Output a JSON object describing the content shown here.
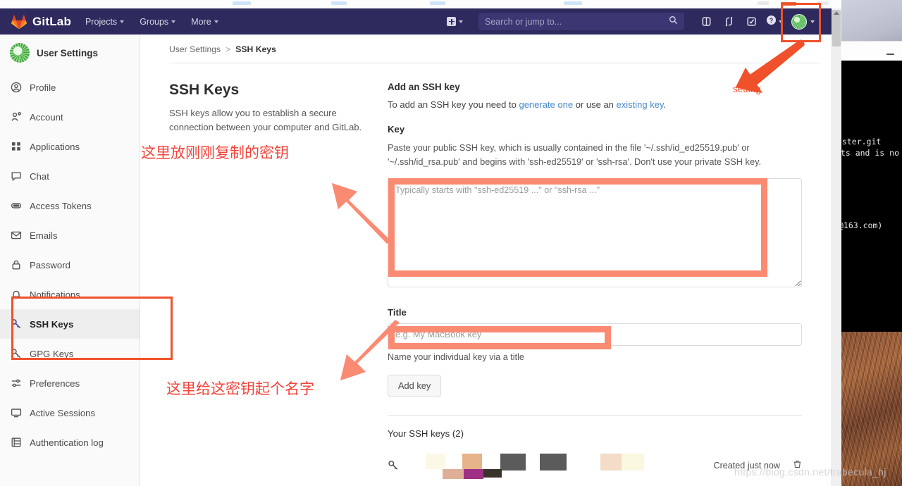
{
  "navbar": {
    "brand": "GitLab",
    "links": [
      {
        "label": "Projects",
        "icon": "chevron-down-icon"
      },
      {
        "label": "Groups",
        "icon": "chevron-down-icon"
      },
      {
        "label": "More",
        "icon": "chevron-down-icon"
      }
    ],
    "search_placeholder": "Search or jump to...",
    "search_value": "",
    "icons": [
      "plus-square-icon",
      "search-icon",
      "issues-icon",
      "merge-requests-icon",
      "todos-icon",
      "help-icon",
      "user-avatar-icon"
    ]
  },
  "sidebar": {
    "header": "User Settings",
    "items": [
      {
        "label": "Profile",
        "icon": "user-circle-icon",
        "active": false
      },
      {
        "label": "Account",
        "icon": "account-gear-icon",
        "active": false
      },
      {
        "label": "Applications",
        "icon": "applications-grid-icon",
        "active": false
      },
      {
        "label": "Chat",
        "icon": "chat-bubble-icon",
        "active": false
      },
      {
        "label": "Access Tokens",
        "icon": "token-icon",
        "active": false
      },
      {
        "label": "Emails",
        "icon": "envelope-icon",
        "active": false
      },
      {
        "label": "Password",
        "icon": "lock-icon",
        "active": false
      },
      {
        "label": "Notifications",
        "icon": "bell-icon",
        "active": false
      },
      {
        "label": "SSH Keys",
        "icon": "key-icon",
        "active": true
      },
      {
        "label": "GPG Keys",
        "icon": "key-icon",
        "active": false
      },
      {
        "label": "Preferences",
        "icon": "sliders-icon",
        "active": false
      },
      {
        "label": "Active Sessions",
        "icon": "monitor-icon",
        "active": false
      },
      {
        "label": "Authentication log",
        "icon": "log-grid-icon",
        "active": false
      }
    ]
  },
  "breadcrumb": {
    "root": "User Settings",
    "separator": ">",
    "current": "SSH Keys"
  },
  "main": {
    "section_title": "SSH Keys",
    "section_desc": "SSH keys allow you to establish a secure connection between your computer and GitLab.",
    "form_title": "Add an SSH key",
    "form_sub_prefix": "To add an SSH key you need to ",
    "form_sub_link1": "generate one",
    "form_sub_middle": " or use an ",
    "form_sub_link2": "existing key",
    "form_sub_suffix": ".",
    "key_label": "Key",
    "key_help": "Paste your public SSH key, which is usually contained in the file '~/.ssh/id_ed25519.pub' or '~/.ssh/id_rsa.pub' and begins with 'ssh-ed25519' or 'ssh-rsa'. Don't use your private SSH key.",
    "key_placeholder": "Typically starts with \"ssh-ed25519 ...\" or \"ssh-rsa ...\"",
    "key_value": "",
    "title_label": "Title",
    "title_placeholder": "e.g. My MacBook key",
    "title_value": "",
    "title_hint": "Name your individual key via a title",
    "add_key_button": "Add key",
    "keys_list_title": "Your SSH keys (2)",
    "key_row_created": "Created just now",
    "key_row_icon": "key-icon",
    "key_row_delete_icon": "trash-icon"
  },
  "annotations": {
    "chinese_note_1": "这里放刚刚复制的密钥",
    "chinese_note_2": "这里给这密钥起个名字",
    "setting_label": "setting",
    "red": "#f0512a",
    "coral": "#fb8a72",
    "cn_red": "#f4433a"
  },
  "background": {
    "terminal_line_1": "aster.git",
    "terminal_line_2": "sts and is no",
    "terminal_line_3": "@163.com)",
    "watermark": "https://blog.csdn.net/trabecula_hj"
  }
}
